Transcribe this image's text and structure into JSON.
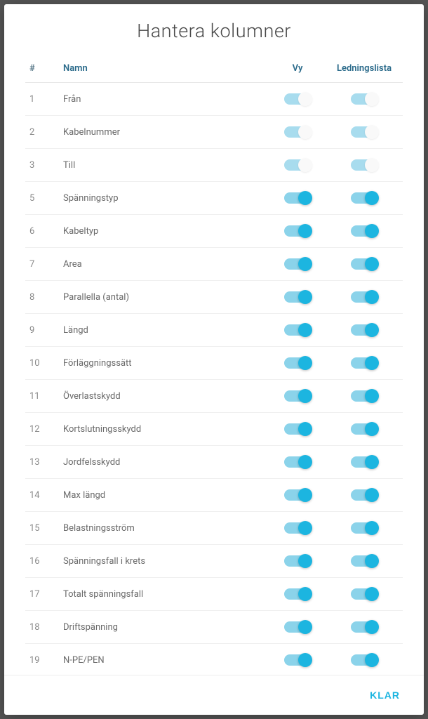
{
  "title": "Hantera kolumner",
  "headers": {
    "number": "#",
    "name": "Namn",
    "view": "Vy",
    "list": "Ledningslista"
  },
  "rows": [
    {
      "num": "1",
      "name": "Från",
      "view_on": true,
      "view_locked": true,
      "list_on": true,
      "list_locked": true
    },
    {
      "num": "2",
      "name": "Kabelnummer",
      "view_on": true,
      "view_locked": true,
      "list_on": true,
      "list_locked": true
    },
    {
      "num": "3",
      "name": "Till",
      "view_on": true,
      "view_locked": true,
      "list_on": true,
      "list_locked": true
    },
    {
      "num": "5",
      "name": "Spänningstyp",
      "view_on": true,
      "view_locked": false,
      "list_on": true,
      "list_locked": false
    },
    {
      "num": "6",
      "name": "Kabeltyp",
      "view_on": true,
      "view_locked": false,
      "list_on": true,
      "list_locked": false
    },
    {
      "num": "7",
      "name": "Area",
      "view_on": true,
      "view_locked": false,
      "list_on": true,
      "list_locked": false
    },
    {
      "num": "8",
      "name": "Parallella (antal)",
      "view_on": true,
      "view_locked": false,
      "list_on": true,
      "list_locked": false
    },
    {
      "num": "9",
      "name": "Längd",
      "view_on": true,
      "view_locked": false,
      "list_on": true,
      "list_locked": false
    },
    {
      "num": "10",
      "name": "Förläggningssätt",
      "view_on": true,
      "view_locked": false,
      "list_on": true,
      "list_locked": false
    },
    {
      "num": "11",
      "name": "Överlastskydd",
      "view_on": true,
      "view_locked": false,
      "list_on": true,
      "list_locked": false
    },
    {
      "num": "12",
      "name": "Kortslutningsskydd",
      "view_on": true,
      "view_locked": false,
      "list_on": true,
      "list_locked": false
    },
    {
      "num": "13",
      "name": "Jordfelsskydd",
      "view_on": true,
      "view_locked": false,
      "list_on": true,
      "list_locked": false
    },
    {
      "num": "14",
      "name": "Max längd",
      "view_on": true,
      "view_locked": false,
      "list_on": true,
      "list_locked": false
    },
    {
      "num": "15",
      "name": "Belastningsström",
      "view_on": true,
      "view_locked": false,
      "list_on": true,
      "list_locked": false
    },
    {
      "num": "16",
      "name": "Spänningsfall i krets",
      "view_on": true,
      "view_locked": false,
      "list_on": true,
      "list_locked": false
    },
    {
      "num": "17",
      "name": "Totalt spänningsfall",
      "view_on": true,
      "view_locked": false,
      "list_on": true,
      "list_locked": false
    },
    {
      "num": "18",
      "name": "Driftspänning",
      "view_on": true,
      "view_locked": false,
      "list_on": true,
      "list_locked": false
    },
    {
      "num": "19",
      "name": "N-PE/PEN",
      "view_on": true,
      "view_locked": false,
      "list_on": true,
      "list_locked": false
    }
  ],
  "footer": {
    "done": "KLAR"
  }
}
